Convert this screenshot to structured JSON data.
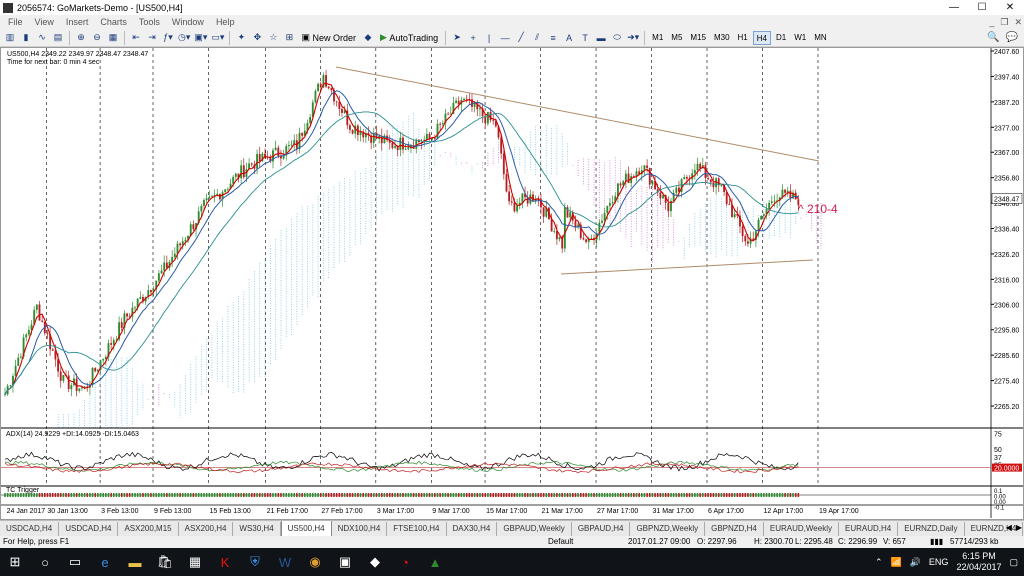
{
  "window": {
    "title": "2056574: GoMarkets-Demo - [US500,H4]"
  },
  "menu": [
    "File",
    "View",
    "Insert",
    "Charts",
    "Tools",
    "Window",
    "Help"
  ],
  "toolbar": {
    "new_order": "New Order",
    "auto_trading": "AutoTrading",
    "text_tool": "A",
    "label_tool": "T",
    "timeframes": [
      "M1",
      "M5",
      "M15",
      "M30",
      "H1",
      "H4",
      "D1",
      "W1",
      "MN"
    ],
    "active_tf": "H4"
  },
  "chart": {
    "symbol_line": "US500,H4  2349.22 2349.97 2348.47 2348.47",
    "next_bar": "Time for next bar: 0 min 4 sec",
    "price_labels": [
      "2407.60",
      "2397.40",
      "2387.20",
      "2377.00",
      "2367.00",
      "2356.80",
      "2346.60",
      "2336.40",
      "2326.20",
      "2316.00",
      "2306.00",
      "2295.80",
      "2285.60",
      "2275.40",
      "2265.20"
    ],
    "current_price": "2348.47",
    "annotation": "210-4",
    "date_labels": [
      "24 Jan 2017",
      "30 Jan 13:00",
      "3 Feb 13:00",
      "9 Feb 13:00",
      "15 Feb 13:00",
      "21 Feb 17:00",
      "27 Feb 17:00",
      "3 Mar 17:00",
      "9 Mar 17:00",
      "15 Mar 17:00",
      "21 Mar 17:00",
      "27 Mar 17:00",
      "31 Mar 17:00",
      "6 Apr 17:00",
      "12 Apr 17:00",
      "19 Apr 17:00"
    ],
    "adx_label": "ADX(14) 24.9229 +DI:14.0925 -DI:15.0463",
    "adx_levels": [
      "75",
      "50",
      "37",
      "25"
    ],
    "adx_marker": "20.0000",
    "tc_label": "TC Trigger",
    "tc_levels": [
      "0.1",
      "0.00",
      "0.00",
      "-0.1"
    ]
  },
  "tabs": [
    "USDCAD,H4",
    "USDCAD,H4",
    "ASX200,M15",
    "ASX200,H4",
    "WS30,H4",
    "US500,H4",
    "NDX100,H4",
    "FTSE100,H4",
    "DAX30,H4",
    "GBPAUD,Weekly",
    "GBPAUD,H4",
    "GBPNZD,Weekly",
    "GBPNZD,H4",
    "EURAUD,Weekly",
    "EURAUD,H4",
    "EURNZD,Daily",
    "EURNZD,H4"
  ],
  "active_tab": "US500,H4",
  "status": {
    "help": "For Help, press F1",
    "profile": "Default",
    "time": "2017.01.27 09:00",
    "open": "O: 2297.96",
    "high": "H: 2300.70",
    "low": "L: 2295.48",
    "close": "C: 2296.99",
    "volume": "V: 657",
    "traffic": "57714/293 kb"
  },
  "taskbar": {
    "lang": "ENG",
    "time": "6:15 PM",
    "date": "22/04/2017"
  },
  "colors": {
    "bull": "#2e8b2e",
    "bear": "#b22222",
    "fast_ma": "#d00000",
    "slow_ma": "#2a5caa",
    "mid_ma": "#2a8f8f",
    "trendline": "#b08b6a",
    "cloud_a": "#7cc8e6",
    "cloud_b": "#d37bd6"
  }
}
